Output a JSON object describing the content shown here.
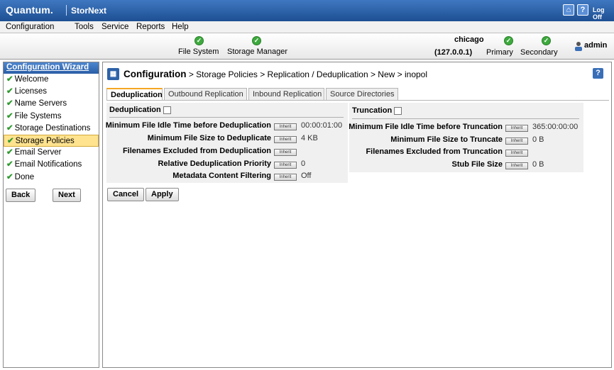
{
  "app": {
    "brand": "Quantum.",
    "product": "StorNext",
    "logoff_label": "Log Off"
  },
  "menu": [
    "Configuration",
    "Tools",
    "Service",
    "Reports",
    "Help"
  ],
  "status": {
    "file_system": "File System",
    "storage_manager": "Storage Manager",
    "host_name": "chicago",
    "host_ip": "(127.0.0.1)",
    "primary": "Primary",
    "secondary": "Secondary",
    "user": "admin",
    "ok_color": "#3daa3d"
  },
  "wizard": {
    "title": "Configuration Wizard",
    "items": [
      {
        "label": "Welcome",
        "active": false
      },
      {
        "label": "Licenses",
        "active": false
      },
      {
        "label": "Name Servers",
        "active": false
      },
      {
        "label": "File Systems",
        "active": false
      },
      {
        "label": "Storage Destinations",
        "active": false
      },
      {
        "label": "Storage Policies",
        "active": true
      },
      {
        "label": "Email Server",
        "active": false
      },
      {
        "label": "Email Notifications",
        "active": false
      },
      {
        "label": "Done",
        "active": false
      }
    ],
    "back_label": "Back",
    "next_label": "Next"
  },
  "breadcrumb": {
    "head": "Configuration",
    "path": " > Storage Policies > Replication / Deduplication > New > inopol"
  },
  "tabs": [
    "Deduplication",
    "Outbound Replication",
    "Inbound Replication",
    "Source Directories"
  ],
  "dedup": {
    "title": "Deduplication",
    "checked": false,
    "rows": [
      {
        "label": "Minimum File Idle Time before Deduplication",
        "value": "00:00:01:00"
      },
      {
        "label": "Minimum File Size to Deduplicate",
        "value": "4 KB"
      },
      {
        "label": "Filenames Excluded from Deduplication",
        "value": ""
      },
      {
        "label": "Relative Deduplication Priority",
        "value": "0"
      },
      {
        "label": "Metadata Content Filtering",
        "value": "Off"
      }
    ]
  },
  "truncation": {
    "title": "Truncation",
    "checked": false,
    "rows": [
      {
        "label": "Minimum File Idle Time before Truncation",
        "value": "365:00:00:00"
      },
      {
        "label": "Minimum File Size to Truncate",
        "value": "0 B"
      },
      {
        "label": "Filenames Excluded from Truncation",
        "value": ""
      },
      {
        "label": "Stub File Size",
        "value": "0 B"
      }
    ]
  },
  "inherit_label": "Inherit",
  "actions": {
    "cancel_label": "Cancel",
    "apply_label": "Apply"
  }
}
